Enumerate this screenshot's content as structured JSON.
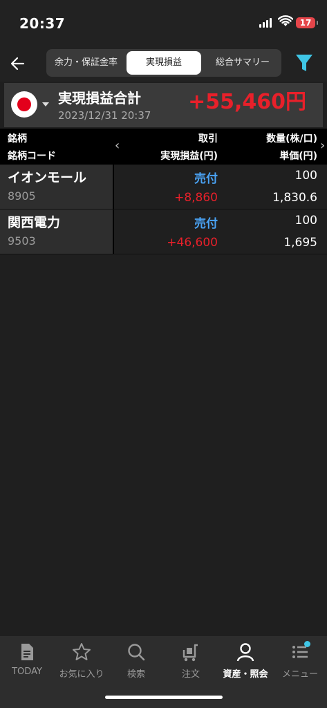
{
  "status": {
    "time": "20:37",
    "battery": "17"
  },
  "nav": {
    "tabs": [
      "余力・保証金率",
      "実現損益",
      "総合サマリー"
    ],
    "active_tab": "実現損益"
  },
  "summary": {
    "title": "実現損益合計",
    "datetime": "2023/12/31 20:37",
    "value": "+55,460円"
  },
  "table": {
    "headers": {
      "col1_top": "銘柄",
      "col1_bottom": "銘柄コード",
      "col2_top": "取引",
      "col2_bottom": "実現損益(円)",
      "col3_top": "数量(株/口)",
      "col3_bottom": "単価(円)"
    },
    "rows": [
      {
        "name": "イオンモール",
        "code": "8905",
        "trade": "売付",
        "pl": "+8,860",
        "qty": "100",
        "price": "1,830.6"
      },
      {
        "name": "関西電力",
        "code": "9503",
        "trade": "売付",
        "pl": "+46,600",
        "qty": "100",
        "price": "1,695"
      }
    ]
  },
  "tabbar": {
    "items": [
      {
        "label": "TODAY",
        "icon": "document-icon"
      },
      {
        "label": "お気に入り",
        "icon": "star-icon"
      },
      {
        "label": "検索",
        "icon": "search-icon"
      },
      {
        "label": "注文",
        "icon": "cart-icon"
      },
      {
        "label": "資産・照会",
        "icon": "person-icon"
      },
      {
        "label": "メニュー",
        "icon": "menu-icon"
      }
    ],
    "active": "資産・照会"
  },
  "colors": {
    "profit": "#e8202a",
    "trade": "#4aa3f5",
    "accent": "#3fc6e6"
  }
}
